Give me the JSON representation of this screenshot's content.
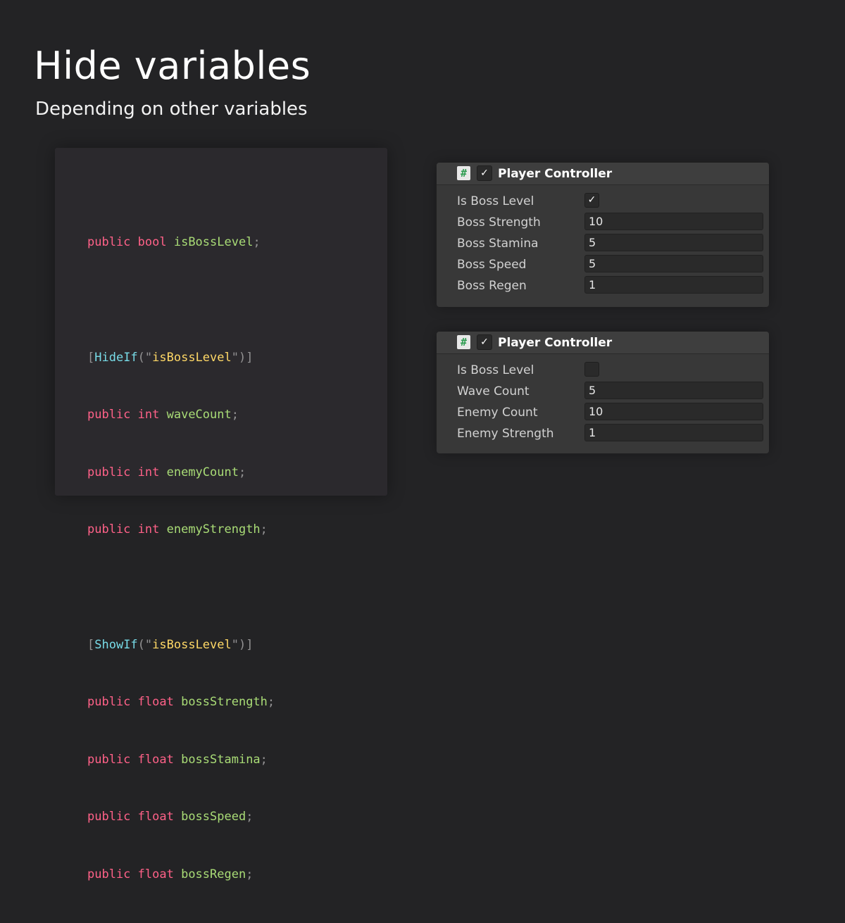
{
  "header": {
    "title": "Hide variables",
    "subtitle": "Depending on other variables"
  },
  "code": {
    "line1": {
      "kw": "public bool",
      "id": "isBossLevel",
      "end": ";"
    },
    "attr_hide": {
      "open": "[",
      "name": "HideIf",
      "paren_open": "(\"",
      "arg": "isBossLevel",
      "paren_close": "\")]"
    },
    "hide_fields": [
      {
        "kw": "public int",
        "id": "waveCount",
        "end": ";"
      },
      {
        "kw": "public int",
        "id": "enemyCount",
        "end": ";"
      },
      {
        "kw": "public int",
        "id": "enemyStrength",
        "end": ";"
      }
    ],
    "attr_show": {
      "open": "[",
      "name": "ShowIf",
      "paren_open": "(\"",
      "arg": "isBossLevel",
      "paren_close": "\")]"
    },
    "show_fields": [
      {
        "kw": "public float",
        "id": "bossStrength",
        "end": ";"
      },
      {
        "kw": "public float",
        "id": "bossStamina",
        "end": ";"
      },
      {
        "kw": "public float",
        "id": "bossSpeed",
        "end": ";"
      },
      {
        "kw": "public float",
        "id": "bossRegen",
        "end": ";"
      }
    ]
  },
  "inspector_boss": {
    "script_icon": "#",
    "enabled_check": "✓",
    "title": "Player Controller",
    "toggle": {
      "label": "Is Boss Level",
      "checked": true,
      "mark": "✓"
    },
    "fields": [
      {
        "label": "Boss Strength",
        "value": "10"
      },
      {
        "label": "Boss Stamina",
        "value": "5"
      },
      {
        "label": "Boss Speed",
        "value": "5"
      },
      {
        "label": "Boss Regen",
        "value": "1"
      }
    ]
  },
  "inspector_wave": {
    "script_icon": "#",
    "enabled_check": "✓",
    "title": "Player Controller",
    "toggle": {
      "label": "Is Boss Level",
      "checked": false,
      "mark": ""
    },
    "fields": [
      {
        "label": "Wave Count",
        "value": "5"
      },
      {
        "label": "Enemy Count",
        "value": "10"
      },
      {
        "label": "Enemy Strength",
        "value": "1"
      }
    ]
  },
  "colors": {
    "background": "#232325",
    "code_panel": "#2b292d",
    "keyword": "#ff6188",
    "identifier": "#a9dc76",
    "attribute": "#78dce8",
    "string": "#ffd866",
    "punctuation": "#939293",
    "inspector_bg": "#383838",
    "field_bg": "#2a2a2a",
    "script_icon_green": "#2f9d52"
  }
}
